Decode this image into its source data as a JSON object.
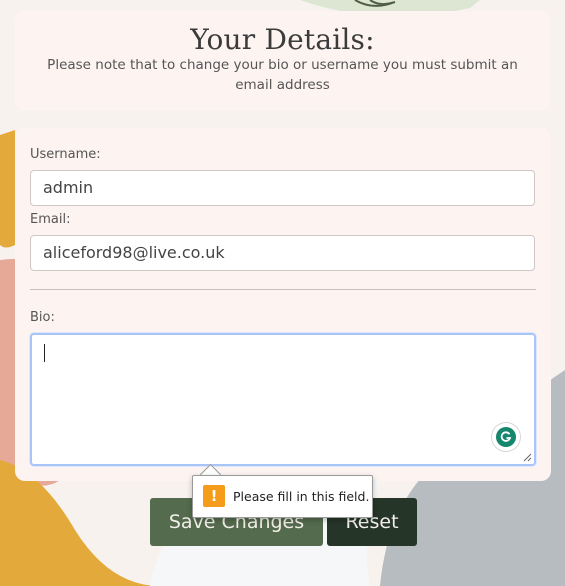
{
  "header": {
    "title": "Your Details:",
    "note": "Please note that to change your bio or username you must submit an email address"
  },
  "form": {
    "username_label": "Username:",
    "username_value": "admin",
    "email_label": "Email:",
    "email_value": "aliceford98@live.co.uk",
    "bio_label": "Bio:",
    "bio_value": ""
  },
  "buttons": {
    "save_label": "Save Changes",
    "reset_label": "Reset"
  },
  "validation_tooltip": {
    "message": "Please fill in this field.",
    "icon": "!"
  },
  "colors": {
    "save_button": "#556b4d",
    "reset_button": "#253528",
    "focus_border": "#a9c4f7",
    "warning": "#f59c1a",
    "grammarly": "#15876d"
  }
}
